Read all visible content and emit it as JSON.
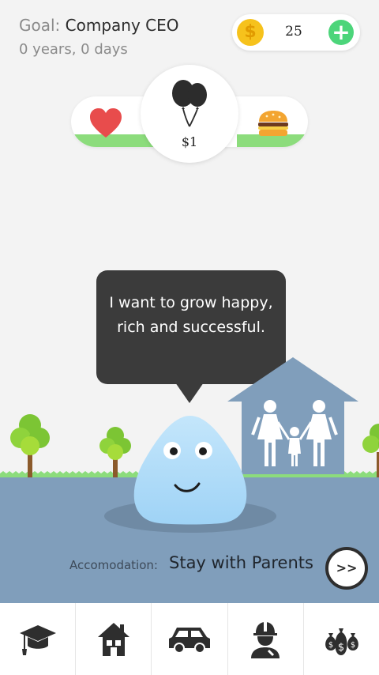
{
  "header": {
    "goal_label": "Goal:",
    "goal_value": "Company CEO",
    "age": "0 years, 0 days"
  },
  "coins": {
    "icon_glyph": "$",
    "count": "25",
    "add_glyph": "+"
  },
  "stats": {
    "money_value": "$1",
    "happiness_icon": "heart-icon",
    "food_icon": "burger-icon",
    "money_icon": "balloons-icon",
    "happiness_level": 0.37,
    "food_level": 0.3
  },
  "speech": {
    "text": "I want to grow happy, rich and successful."
  },
  "accommodation": {
    "label": "Accomodation:",
    "value": "Stay with Parents",
    "next_glyph": ">>"
  },
  "nav": {
    "items": [
      {
        "icon": "graduation-cap-icon"
      },
      {
        "icon": "house-icon"
      },
      {
        "icon": "car-icon"
      },
      {
        "icon": "worker-icon"
      },
      {
        "icon": "money-bags-icon"
      }
    ]
  },
  "colors": {
    "ground": "#809ebb",
    "house": "#809ebb",
    "grass": "#8cdc7c",
    "bubble": "#3b3b3b",
    "blob": "#a8d8f7",
    "coin": "#f6c21c",
    "add": "#4cd57a",
    "heart": "#e84c4c"
  }
}
